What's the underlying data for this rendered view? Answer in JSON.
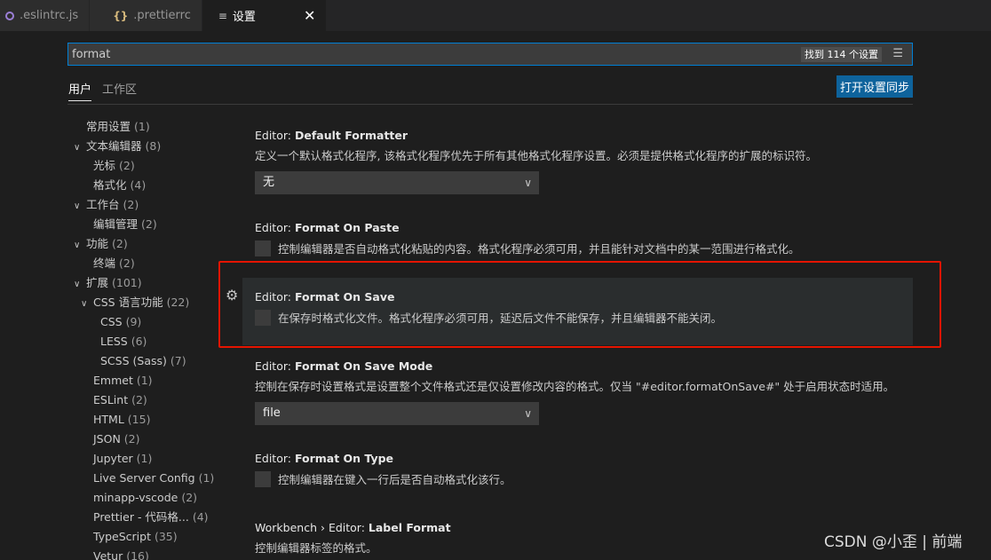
{
  "tabs": [
    {
      "label": ".eslintrc.js",
      "icon": "eslint-file-icon"
    },
    {
      "label": ".prettierrc",
      "icon": "json-braces-icon"
    },
    {
      "label": "设置",
      "icon": "settings-lines-icon",
      "close": "✕"
    }
  ],
  "search": {
    "value": "format",
    "result_count": "找到 114 个设置"
  },
  "scope_tabs": {
    "user": "用户",
    "workspace": "工作区"
  },
  "sync_button": "打开设置同步",
  "tree": [
    {
      "label": "常用设置",
      "count": "(1)"
    },
    {
      "label": "文本编辑器",
      "count": "(8)"
    },
    {
      "label": "光标",
      "count": "(2)"
    },
    {
      "label": "格式化",
      "count": "(4)"
    },
    {
      "label": "工作台",
      "count": "(2)"
    },
    {
      "label": "编辑管理",
      "count": "(2)"
    },
    {
      "label": "功能",
      "count": "(2)"
    },
    {
      "label": "终端",
      "count": "(2)"
    },
    {
      "label": "扩展",
      "count": "(101)"
    },
    {
      "label": "CSS 语言功能",
      "count": "(22)"
    },
    {
      "label": "CSS",
      "count": "(9)"
    },
    {
      "label": "LESS",
      "count": "(6)"
    },
    {
      "label": "SCSS (Sass)",
      "count": "(7)"
    },
    {
      "label": "Emmet",
      "count": "(1)"
    },
    {
      "label": "ESLint",
      "count": "(2)"
    },
    {
      "label": "HTML",
      "count": "(15)"
    },
    {
      "label": "JSON",
      "count": "(2)"
    },
    {
      "label": "Jupyter",
      "count": "(1)"
    },
    {
      "label": "Live Server Config",
      "count": "(1)"
    },
    {
      "label": "minapp-vscode",
      "count": "(2)"
    },
    {
      "label": "Prettier - 代码格...",
      "count": "(4)"
    },
    {
      "label": "TypeScript",
      "count": "(35)"
    },
    {
      "label": "Vetur",
      "count": "(16)"
    }
  ],
  "settings": [
    {
      "category": "Editor: ",
      "name": "Default Formatter",
      "desc": "定义一个默认格式化程序, 该格式化程序优先于所有其他格式化程序设置。必须是提供格式化程序的扩展的标识符。",
      "select": "无"
    },
    {
      "category": "Editor: ",
      "name": "Format On Paste",
      "desc": "控制编辑器是否自动格式化粘贴的内容。格式化程序必须可用，并且能针对文档中的某一范围进行格式化。"
    },
    {
      "category": "Editor: ",
      "name": "Format On Save",
      "desc": "在保存时格式化文件。格式化程序必须可用，延迟后文件不能保存，并且编辑器不能关闭。"
    },
    {
      "category": "Editor: ",
      "name": "Format On Save Mode",
      "desc": "控制在保存时设置格式是设置整个文件格式还是仅设置修改内容的格式。仅当 \"#editor.formatOnSave#\" 处于启用状态时适用。",
      "select": "file"
    },
    {
      "category": "Editor: ",
      "name": "Format On Type",
      "desc": "控制编辑器在键入一行后是否自动格式化该行。"
    },
    {
      "category": "Workbench › Editor: ",
      "name": "Label Format",
      "desc": "控制编辑器标签的格式。"
    }
  ],
  "watermark": "CSDN @小歪 | 前端",
  "colors": {
    "accent": "#0e639c",
    "focus_border": "#007fd4",
    "highlight": "#e51400"
  }
}
